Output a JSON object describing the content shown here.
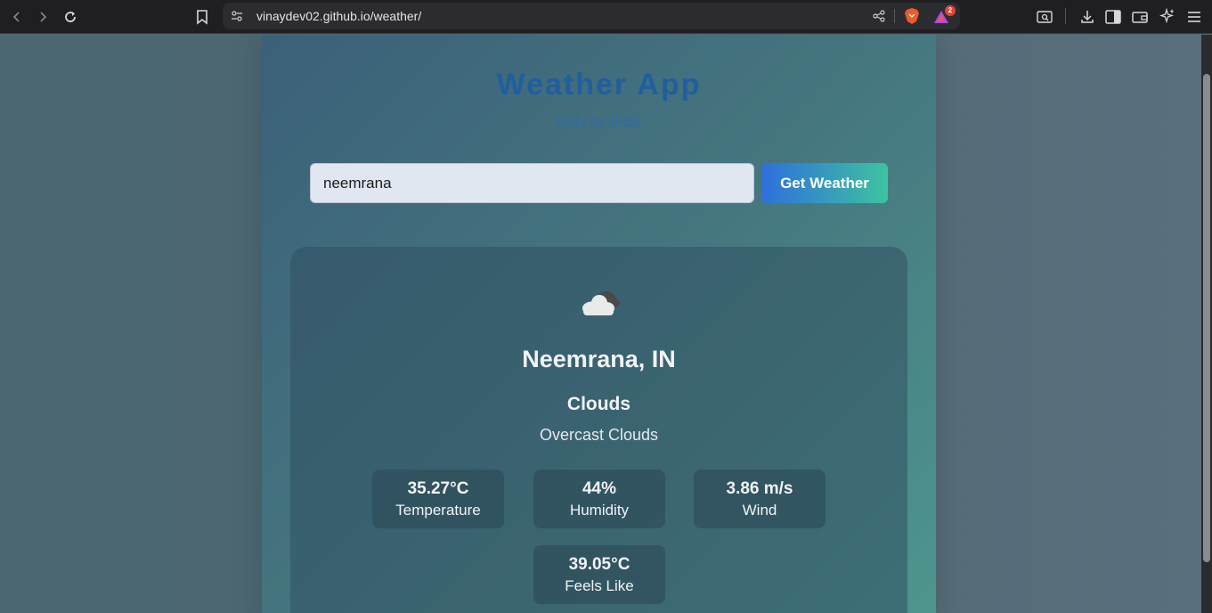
{
  "browser": {
    "url": "vinaydev02.github.io/weather/",
    "notification_count": "2"
  },
  "app": {
    "title": "Weather App",
    "subtitle": "Only for India"
  },
  "search": {
    "value": "neemrana",
    "button_label": "Get Weather"
  },
  "weather": {
    "icon": "cloud-icon",
    "location": "Neemrana, IN",
    "condition": "Clouds",
    "description": "Overcast Clouds",
    "stats": [
      {
        "value": "35.27°C",
        "label": "Temperature"
      },
      {
        "value": "44%",
        "label": "Humidity"
      },
      {
        "value": "3.86 m/s",
        "label": "Wind"
      },
      {
        "value": "39.05°C",
        "label": "Feels Like"
      }
    ]
  },
  "colors": {
    "title": "#1f5f9f",
    "button_start": "#2e6fdc",
    "button_end": "#3ec3a0"
  }
}
